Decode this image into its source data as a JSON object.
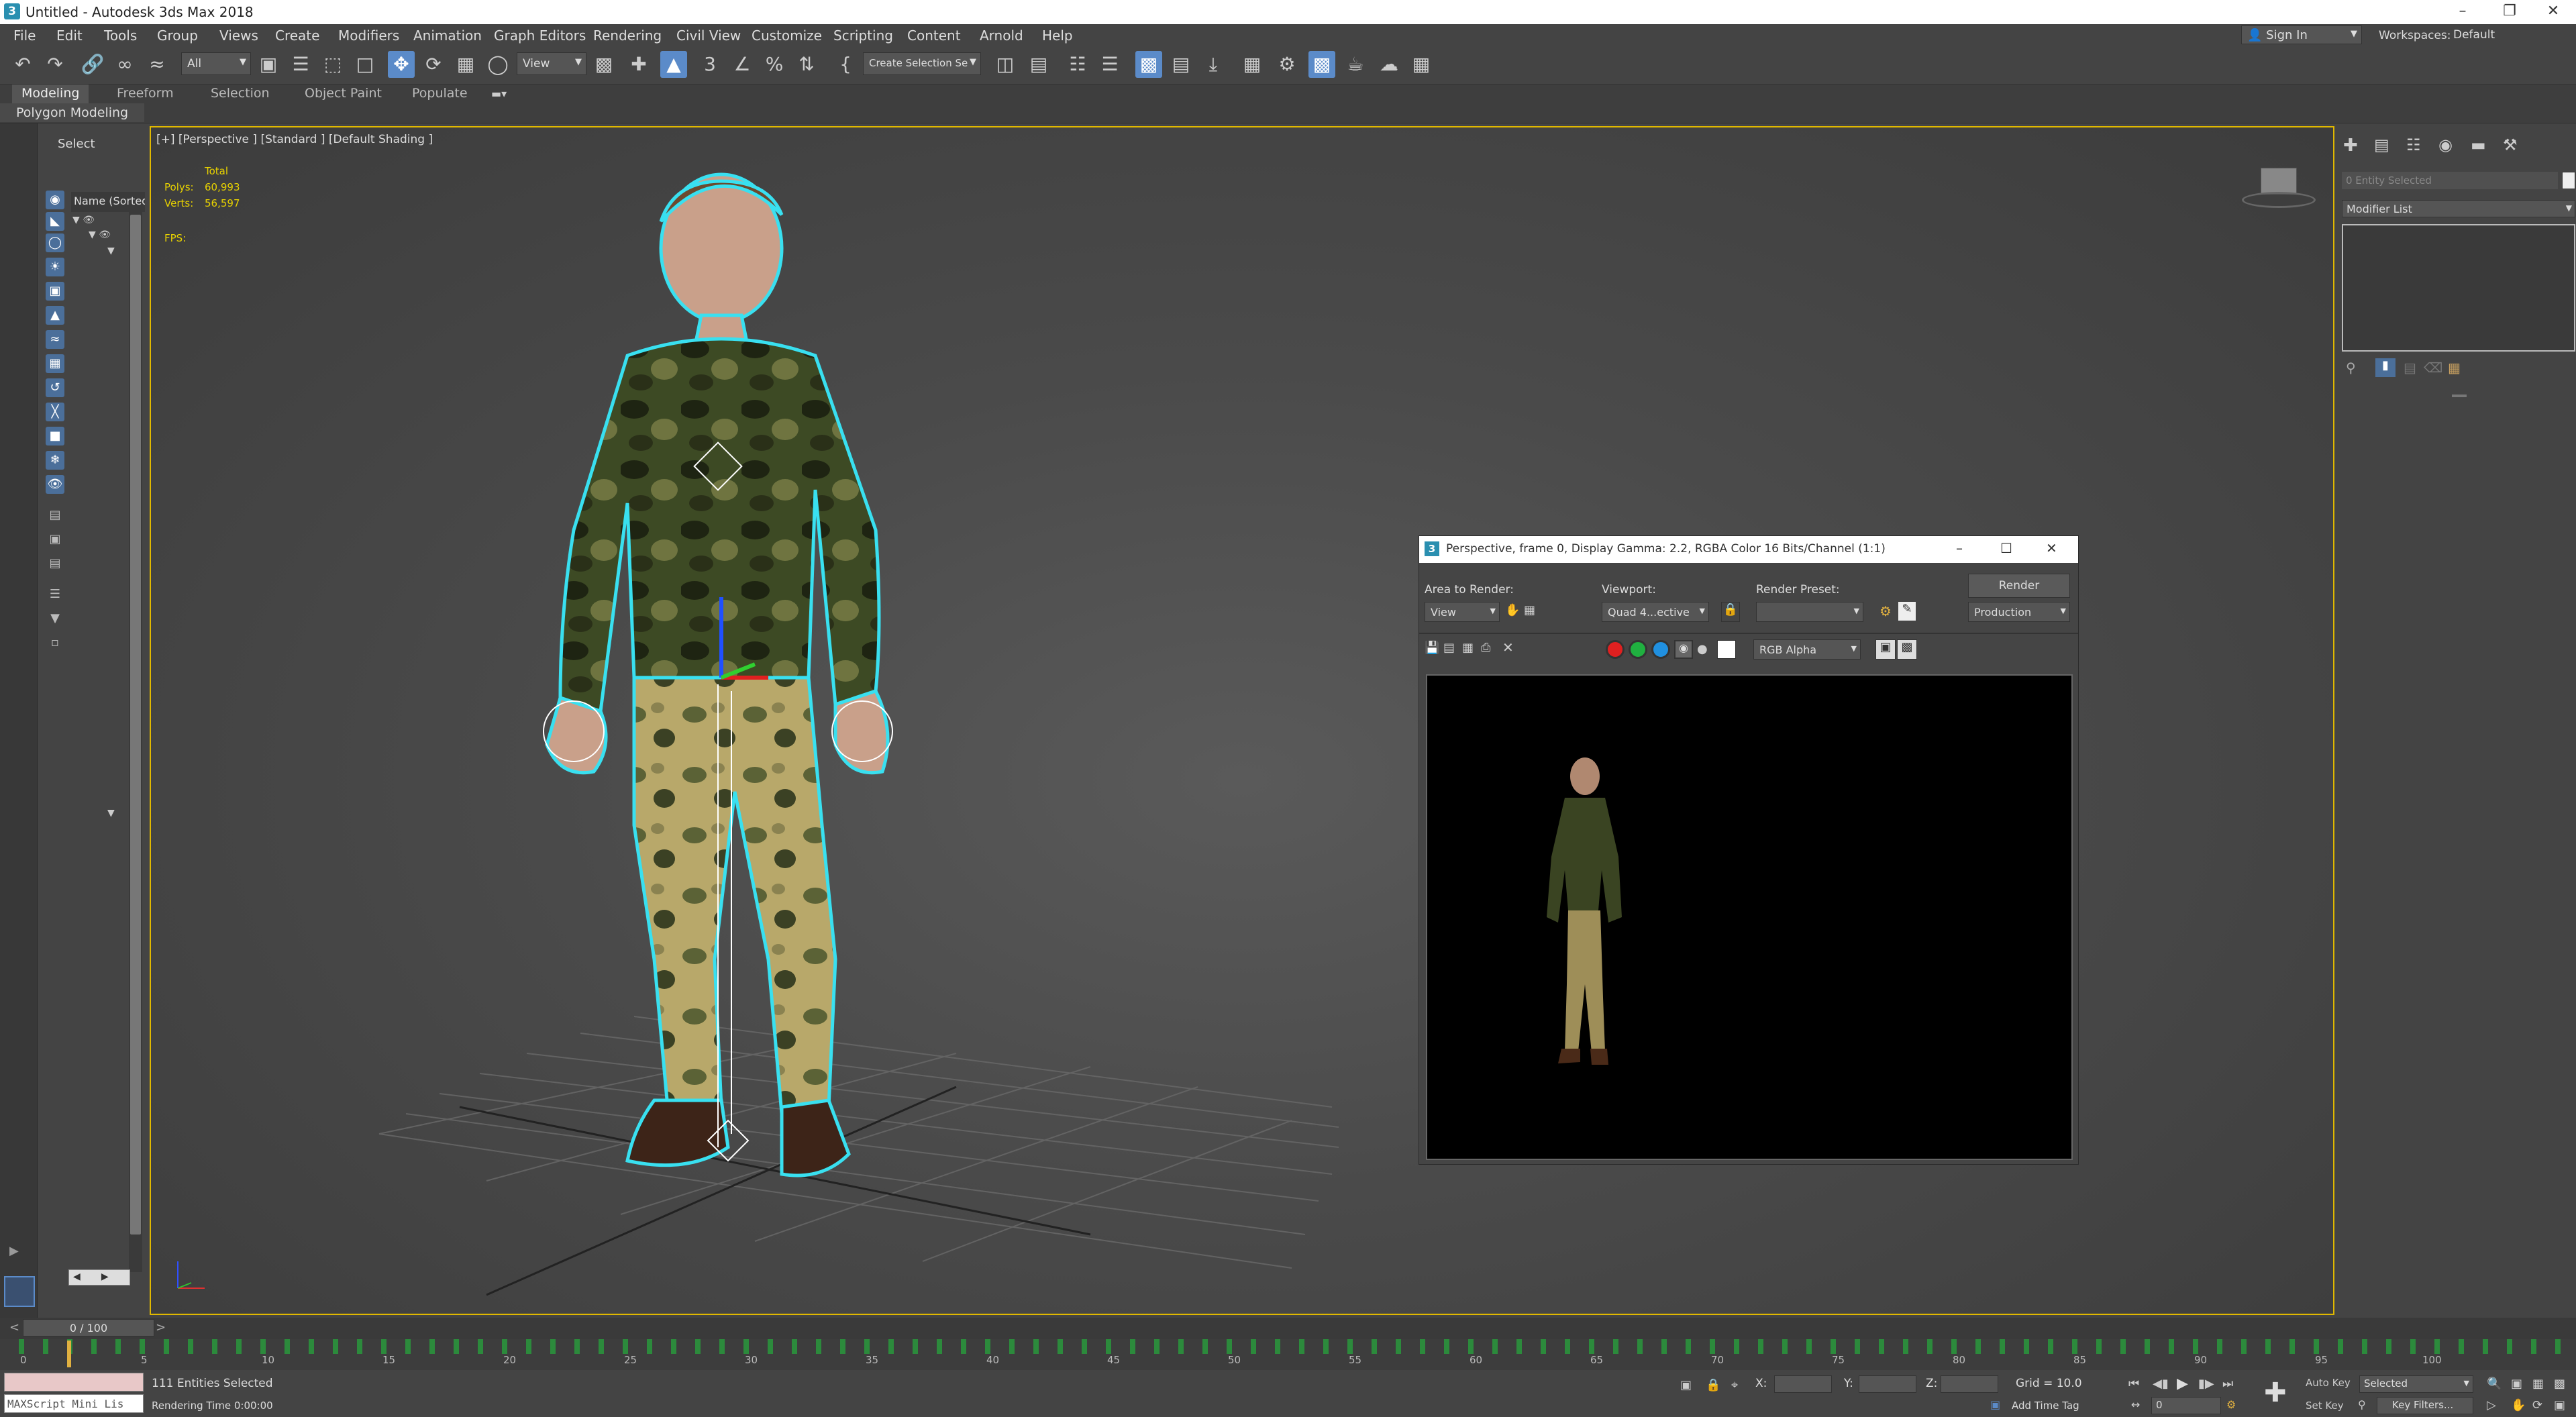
{
  "window": {
    "title": "Untitled - Autodesk 3ds Max 2018",
    "app_icon": "3"
  },
  "menubar": {
    "items": [
      "File",
      "Edit",
      "Tools",
      "Group",
      "Views",
      "Create",
      "Modifiers",
      "Animation",
      "Graph Editors",
      "Rendering",
      "Civil View",
      "Customize",
      "Scripting",
      "Content",
      "Arnold",
      "Help"
    ],
    "sign_in": "Sign In",
    "workspaces_label": "Workspaces:",
    "workspaces_value": "Default"
  },
  "toolbar": {
    "selection_filter": "All",
    "ref_coord": "View",
    "named_selection": "Create Selection Se"
  },
  "ribbon": {
    "tabs": [
      "Modeling",
      "Freeform",
      "Selection",
      "Object Paint",
      "Populate"
    ],
    "subtab": "Polygon Modeling"
  },
  "explorer": {
    "select_label": "Select",
    "name_column": "Name (Sorted A"
  },
  "viewport": {
    "label": "[+] [Perspective ] [Standard ] [Default Shading ]",
    "stats": {
      "total_label": "Total",
      "polys_label": "Polys:",
      "polys_value": "60,993",
      "verts_label": "Verts:",
      "verts_value": "56,597",
      "fps_label": "FPS:"
    }
  },
  "cmdpanel": {
    "selection_field": "0 Entity Selected",
    "modifier_list": "Modifier List"
  },
  "render_window": {
    "title": "Perspective, frame 0, Display Gamma: 2.2, RGBA Color 16 Bits/Channel (1:1)",
    "area_label": "Area to Render:",
    "area_value": "View",
    "viewport_label": "Viewport:",
    "viewport_value": "Quad 4...ective",
    "preset_label": "Render Preset:",
    "preset_value": "",
    "render_button": "Render",
    "production_value": "Production",
    "channel_value": "RGB Alpha",
    "colors": {
      "red": "#e02020",
      "green": "#20b040",
      "blue": "#2090e0"
    }
  },
  "timeline": {
    "frame_counter": "0 / 100",
    "ticks": [
      "0",
      "5",
      "10",
      "15",
      "20",
      "25",
      "30",
      "35",
      "40",
      "45",
      "50",
      "55",
      "60",
      "65",
      "70",
      "75",
      "80",
      "85",
      "90",
      "95",
      "100"
    ]
  },
  "statusbar": {
    "maxscript": "MAXScript Mini Lis",
    "selected_text": "111 Entities Selected",
    "render_time": "Rendering Time  0:00:00",
    "x_label": "X:",
    "y_label": "Y:",
    "z_label": "Z:",
    "grid": "Grid = 10.0",
    "add_time_tag": "Add Time Tag",
    "auto_key": "Auto Key",
    "set_key": "Set Key",
    "key_mode": "Selected",
    "key_filters": "Key Filters...",
    "current_frame": "0"
  }
}
